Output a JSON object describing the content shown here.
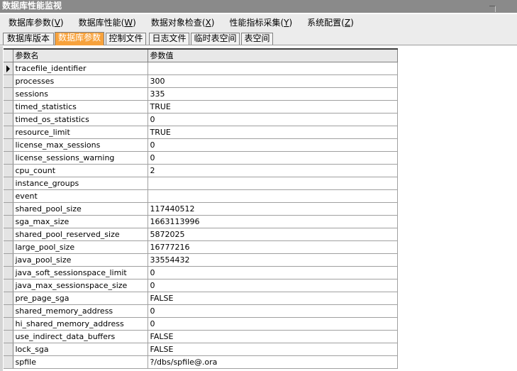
{
  "window": {
    "title": "数据库性能监视"
  },
  "menu": [
    {
      "label": "数据库参数(",
      "hotkey": "V",
      "tail": ")"
    },
    {
      "label": "数据库性能(",
      "hotkey": "W",
      "tail": ")"
    },
    {
      "label": "数据对象检查(",
      "hotkey": "X",
      "tail": ")"
    },
    {
      "label": "性能指标采集(",
      "hotkey": "Y",
      "tail": ")"
    },
    {
      "label": "系统配置(",
      "hotkey": "Z",
      "tail": ")"
    }
  ],
  "tabs": [
    {
      "label": "数据库版本",
      "active": false
    },
    {
      "label": "数据库参数",
      "active": true
    },
    {
      "label": "控制文件",
      "active": false
    },
    {
      "label": "日志文件",
      "active": false
    },
    {
      "label": "临时表空间",
      "active": false
    },
    {
      "label": "表空间",
      "active": false
    }
  ],
  "grid": {
    "columns": [
      "参数名",
      "参数值"
    ],
    "rows": [
      {
        "name": "tracefile_identifier",
        "value": ""
      },
      {
        "name": "processes",
        "value": "300"
      },
      {
        "name": "sessions",
        "value": "335"
      },
      {
        "name": "timed_statistics",
        "value": "TRUE"
      },
      {
        "name": "timed_os_statistics",
        "value": "0"
      },
      {
        "name": "resource_limit",
        "value": "TRUE"
      },
      {
        "name": "license_max_sessions",
        "value": "0"
      },
      {
        "name": "license_sessions_warning",
        "value": "0"
      },
      {
        "name": "cpu_count",
        "value": "2"
      },
      {
        "name": "instance_groups",
        "value": ""
      },
      {
        "name": "event",
        "value": ""
      },
      {
        "name": "shared_pool_size",
        "value": "117440512"
      },
      {
        "name": "sga_max_size",
        "value": "1663113996"
      },
      {
        "name": "shared_pool_reserved_size",
        "value": "5872025"
      },
      {
        "name": "large_pool_size",
        "value": "16777216"
      },
      {
        "name": "java_pool_size",
        "value": "33554432"
      },
      {
        "name": "java_soft_sessionspace_limit",
        "value": "0"
      },
      {
        "name": "java_max_sessionspace_size",
        "value": "0"
      },
      {
        "name": "pre_page_sga",
        "value": "FALSE"
      },
      {
        "name": "shared_memory_address",
        "value": "0"
      },
      {
        "name": "hi_shared_memory_address",
        "value": "0"
      },
      {
        "name": "use_indirect_data_buffers",
        "value": "FALSE"
      },
      {
        "name": "lock_sga",
        "value": "FALSE"
      },
      {
        "name": "spfile",
        "value": "?/dbs/spfile@.ora"
      }
    ],
    "current_row": 0
  },
  "colors": {
    "titlebar": "#8a8a8a",
    "menubar": "#ececec",
    "active_tab": "#f7a23c",
    "grid_lines": "#a0a0a0"
  },
  "icons": {
    "row_indicator": "current-row-triangle-icon"
  }
}
